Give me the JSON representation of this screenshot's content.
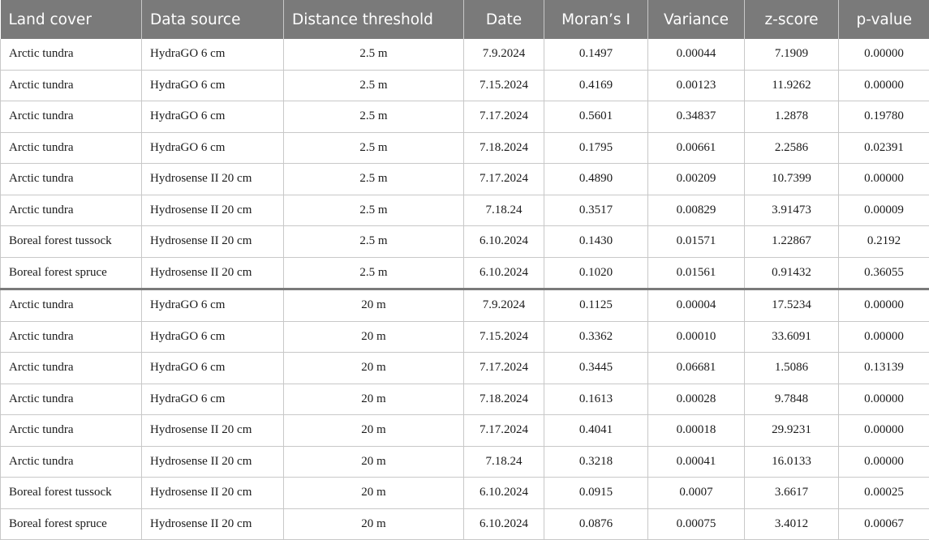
{
  "table": {
    "headers": [
      "Land cover",
      "Data source",
      "Distance threshold",
      "Date",
      "Moran’s I",
      "Variance",
      "z-score",
      "p-value"
    ],
    "rows": [
      [
        "Arctic tundra",
        "HydraGO 6 cm",
        "2.5 m",
        "7.9.2024",
        "0.1497",
        "0.00044",
        "7.1909",
        "0.00000"
      ],
      [
        "Arctic tundra",
        "HydraGO 6 cm",
        "2.5 m",
        "7.15.2024",
        "0.4169",
        "0.00123",
        "11.9262",
        "0.00000"
      ],
      [
        "Arctic tundra",
        "HydraGO 6 cm",
        "2.5 m",
        "7.17.2024",
        "0.5601",
        "0.34837",
        "1.2878",
        "0.19780"
      ],
      [
        "Arctic tundra",
        "HydraGO 6 cm",
        "2.5 m",
        "7.18.2024",
        "0.1795",
        "0.00661",
        "2.2586",
        "0.02391"
      ],
      [
        "Arctic tundra",
        "Hydrosense II 20 cm",
        "2.5 m",
        "7.17.2024",
        "0.4890",
        "0.00209",
        "10.7399",
        "0.00000"
      ],
      [
        "Arctic tundra",
        "Hydrosense II 20 cm",
        "2.5 m",
        "7.18.24",
        "0.3517",
        "0.00829",
        "3.91473",
        "0.00009"
      ],
      [
        "Boreal forest tussock",
        "Hydrosense II 20 cm",
        "2.5 m",
        "6.10.2024",
        "0.1430",
        "0.01571",
        "1.22867",
        "0.2192"
      ],
      [
        "Boreal forest spruce",
        "Hydrosense II 20 cm",
        "2.5 m",
        "6.10.2024",
        "0.1020",
        "0.01561",
        "0.91432",
        "0.36055"
      ],
      [
        "Arctic tundra",
        "HydraGO 6 cm",
        "20 m",
        "7.9.2024",
        "0.1125",
        "0.00004",
        "17.5234",
        "0.00000"
      ],
      [
        "Arctic tundra",
        "HydraGO 6 cm",
        "20 m",
        "7.15.2024",
        "0.3362",
        "0.00010",
        "33.6091",
        "0.00000"
      ],
      [
        "Arctic tundra",
        "HydraGO 6 cm",
        "20 m",
        "7.17.2024",
        "0.3445",
        "0.06681",
        "1.5086",
        "0.13139"
      ],
      [
        "Arctic tundra",
        "HydraGO 6 cm",
        "20 m",
        "7.18.2024",
        "0.1613",
        "0.00028",
        "9.7848",
        "0.00000"
      ],
      [
        "Arctic tundra",
        "Hydrosense II 20 cm",
        "20 m",
        "7.17.2024",
        "0.4041",
        "0.00018",
        "29.9231",
        "0.00000"
      ],
      [
        "Arctic tundra",
        "Hydrosense II 20 cm",
        "20 m",
        "7.18.24",
        "0.3218",
        "0.00041",
        "16.0133",
        "0.00000"
      ],
      [
        "Boreal forest tussock",
        "Hydrosense II 20 cm",
        "20 m",
        "6.10.2024",
        "0.0915",
        "0.0007",
        "3.6617",
        "0.00025"
      ],
      [
        "Boreal forest spruce",
        "Hydrosense II 20 cm",
        "20 m",
        "6.10.2024",
        "0.0876",
        "0.00075",
        "3.4012",
        "0.00067"
      ]
    ]
  }
}
